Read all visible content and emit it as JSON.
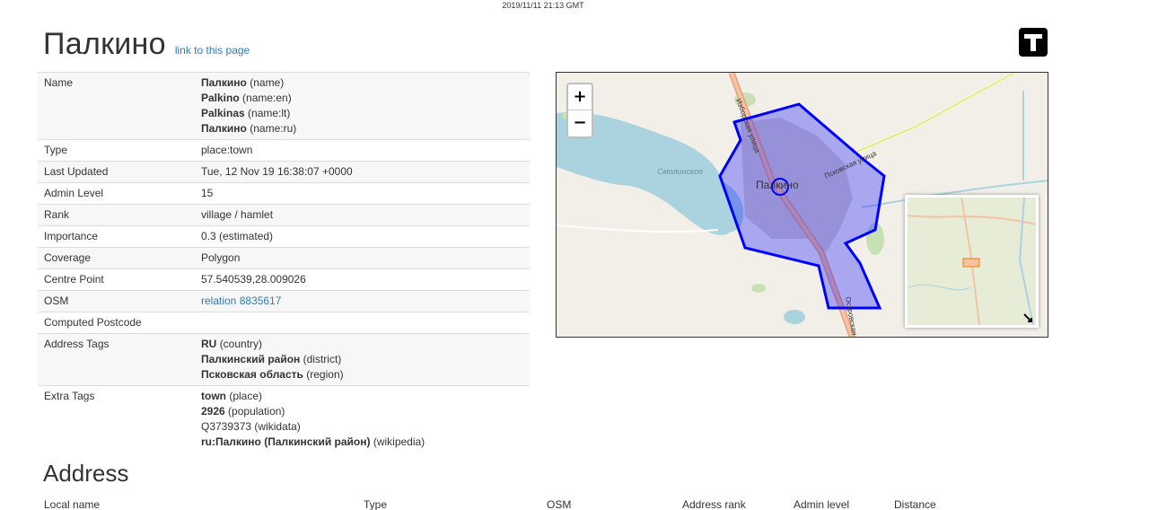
{
  "timestamp": "2019/11/11 21:13 GMT",
  "header": {
    "title": "Палкино",
    "link_label": "link to this page"
  },
  "logo": {
    "icon": "tools-logo-icon"
  },
  "details": {
    "name_label": "Name",
    "names": [
      {
        "value": "Палкино",
        "key": "(name)"
      },
      {
        "value": "Palkino",
        "key": "(name:en)"
      },
      {
        "value": "Palkinas",
        "key": "(name:lt)"
      },
      {
        "value": "Палкино",
        "key": "(name:ru)"
      }
    ],
    "type_label": "Type",
    "type": "place:town",
    "updated_label": "Last Updated",
    "updated": "Tue, 12 Nov 19 16:38:07 +0000",
    "admin_label": "Admin Level",
    "admin": "15",
    "rank_label": "Rank",
    "rank": "village / hamlet",
    "importance_label": "Importance",
    "importance": "0.3 (estimated)",
    "coverage_label": "Coverage",
    "coverage": "Polygon",
    "centre_label": "Centre Point",
    "centre": "57.540539,28.009026",
    "osm_label": "OSM",
    "osm": "relation 8835617",
    "postcode_label": "Computed Postcode",
    "postcode": "",
    "address_tags_label": "Address Tags",
    "address_tags": [
      {
        "value": "RU",
        "key": "(country)"
      },
      {
        "value": "Палкинский район",
        "key": "(district)"
      },
      {
        "value": "Псковская область",
        "key": "(region)"
      }
    ],
    "extra_tags_label": "Extra Tags",
    "extra_tags": [
      {
        "value": "town",
        "key": "(place)",
        "bold": true
      },
      {
        "value": "2926",
        "key": "(population)",
        "bold": true
      },
      {
        "value": "Q3739373",
        "key": "(wikidata)",
        "bold": false
      },
      {
        "value": "ru:Палкино (Палкинский район)",
        "key": "(wikipedia)",
        "bold": true
      }
    ]
  },
  "map": {
    "zoom_in": "+",
    "zoom_out": "−",
    "city_label": "Палкино",
    "street_1": "Псковская улица",
    "street_2": "Изборская улица",
    "street_3": "Островская",
    "lake_label": "Смолинское",
    "polygon_color": "#0000ff"
  },
  "address": {
    "heading": "Address",
    "columns": [
      "Local name",
      "Type",
      "OSM",
      "Address rank",
      "Admin level",
      "Distance"
    ]
  }
}
